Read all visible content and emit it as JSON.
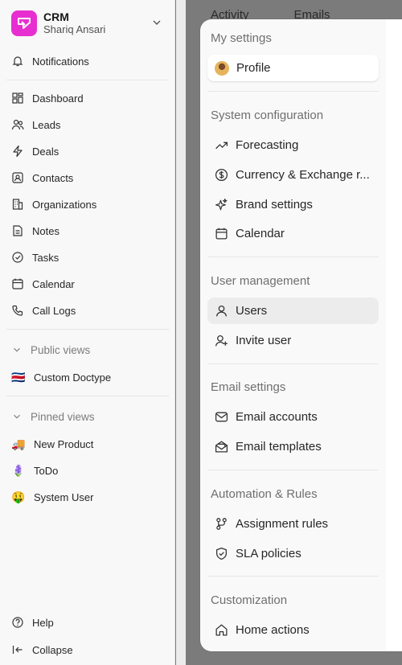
{
  "sidebar": {
    "app_name": "CRM",
    "user_name": "Shariq Ansari",
    "notifications": "Notifications",
    "items": [
      "Dashboard",
      "Leads",
      "Deals",
      "Contacts",
      "Organizations",
      "Notes",
      "Tasks",
      "Calendar",
      "Call Logs"
    ],
    "public_views_label": "Public views",
    "public_views": [
      {
        "emoji": "🇨🇷",
        "label": "Custom Doctype"
      }
    ],
    "pinned_views_label": "Pinned views",
    "pinned_views": [
      {
        "emoji": "🚚",
        "label": "New Product"
      },
      {
        "emoji": "🪻",
        "label": "ToDo"
      },
      {
        "emoji": "🤑",
        "label": "System User"
      }
    ],
    "help": "Help",
    "collapse": "Collapse",
    "brand_color": "#e72fd1"
  },
  "background": {
    "tab_activity": "Activity",
    "tab_emails": "Emails"
  },
  "settings": {
    "my_settings": {
      "title": "My settings",
      "items": [
        "Profile"
      ]
    },
    "system_configuration": {
      "title": "System configuration",
      "items": [
        "Forecasting",
        "Currency & Exchange r...",
        "Brand settings",
        "Calendar"
      ]
    },
    "user_management": {
      "title": "User management",
      "items": [
        "Users",
        "Invite user"
      ]
    },
    "email_settings": {
      "title": "Email settings",
      "items": [
        "Email accounts",
        "Email templates"
      ]
    },
    "automation_rules": {
      "title": "Automation & Rules",
      "items": [
        "Assignment rules",
        "SLA policies"
      ]
    },
    "customization": {
      "title": "Customization",
      "items": [
        "Home actions"
      ]
    }
  }
}
